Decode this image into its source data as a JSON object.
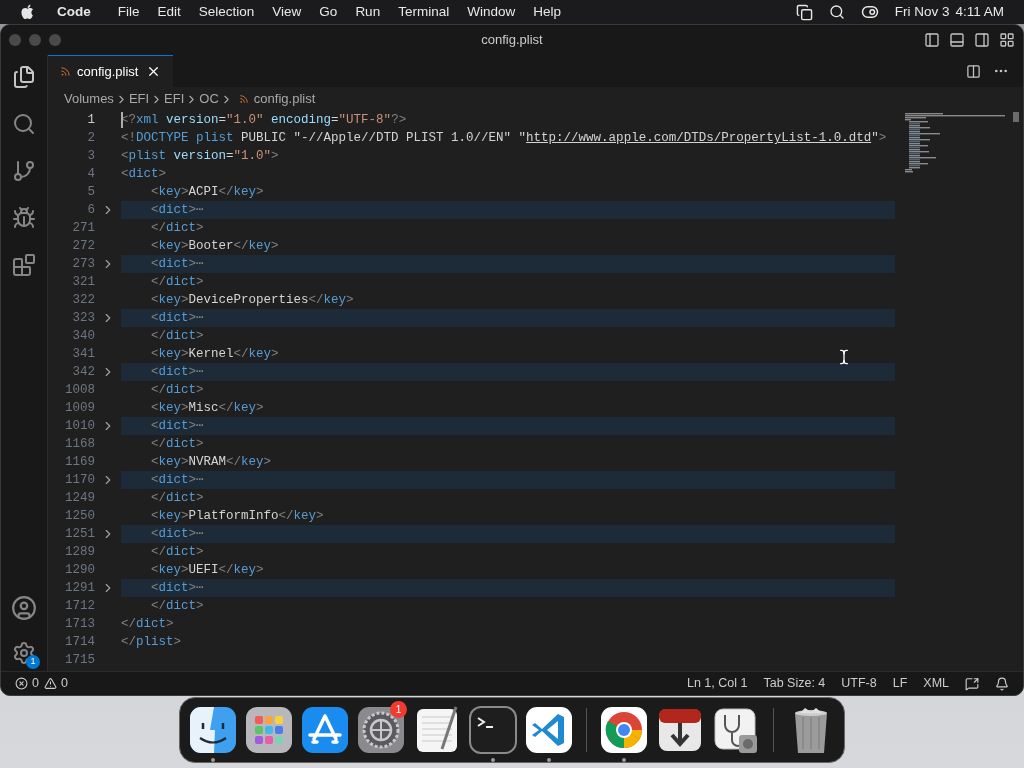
{
  "menubar": {
    "app": "Code",
    "menus": [
      "File",
      "Edit",
      "Selection",
      "View",
      "Go",
      "Run",
      "Terminal",
      "Window",
      "Help"
    ],
    "date": "Fri Nov 3",
    "time": "4:11 AM"
  },
  "window": {
    "title": "config.plist"
  },
  "activity_bar": {
    "settings_badge": "1"
  },
  "tabs": [
    {
      "label": "config.plist",
      "selected": true
    }
  ],
  "breadcrumbs": [
    "Volumes",
    "EFI",
    "EFI",
    "OC",
    "config.plist"
  ],
  "editor": {
    "lines": [
      {
        "number": "1",
        "current": true,
        "folded": false,
        "tokens": [
          {
            "kind": "punct",
            "text": "<?"
          },
          {
            "kind": "tag",
            "text": "xml"
          },
          {
            "kind": "attr",
            "text": " version"
          },
          {
            "kind": "text",
            "text": "="
          },
          {
            "kind": "string",
            "text": "\"1.0\""
          },
          {
            "kind": "attr",
            "text": " encoding"
          },
          {
            "kind": "text",
            "text": "="
          },
          {
            "kind": "string",
            "text": "\"UTF-8\""
          },
          {
            "kind": "punct",
            "text": "?>"
          }
        ]
      },
      {
        "number": "2",
        "current": false,
        "folded": false,
        "tokens": [
          {
            "kind": "punct",
            "text": "<!"
          },
          {
            "kind": "tag",
            "text": "DOCTYPE plist"
          },
          {
            "kind": "text",
            "text": " PUBLIC \"-//Apple//DTD PLIST 1.0//EN\" \""
          },
          {
            "kind": "link",
            "text": "http://www.apple.com/DTDs/PropertyList-1.0.dtd"
          },
          {
            "kind": "text",
            "text": "\""
          },
          {
            "kind": "punct",
            "text": ">"
          }
        ]
      },
      {
        "number": "3",
        "current": false,
        "folded": false,
        "tokens": [
          {
            "kind": "punct",
            "text": "<"
          },
          {
            "kind": "tag",
            "text": "plist"
          },
          {
            "kind": "attr",
            "text": " version"
          },
          {
            "kind": "text",
            "text": "="
          },
          {
            "kind": "string",
            "text": "\"1.0\""
          },
          {
            "kind": "punct",
            "text": ">"
          }
        ]
      },
      {
        "number": "4",
        "current": false,
        "folded": false,
        "tokens": [
          {
            "kind": "punct",
            "text": "<"
          },
          {
            "kind": "tag",
            "text": "dict"
          },
          {
            "kind": "punct",
            "text": ">"
          }
        ]
      },
      {
        "number": "5",
        "current": false,
        "folded": false,
        "tokens": [
          {
            "kind": "punct",
            "text": "    <"
          },
          {
            "kind": "tag",
            "text": "key"
          },
          {
            "kind": "punct",
            "text": ">"
          },
          {
            "kind": "text",
            "text": "ACPI"
          },
          {
            "kind": "punct",
            "text": "</"
          },
          {
            "kind": "tag",
            "text": "key"
          },
          {
            "kind": "punct",
            "text": ">"
          }
        ]
      },
      {
        "number": "6",
        "current": false,
        "folded": true,
        "tokens": [
          {
            "kind": "punct",
            "text": "    <"
          },
          {
            "kind": "tag",
            "text": "dict"
          },
          {
            "kind": "punct",
            "text": ">"
          },
          {
            "kind": "ellipsis",
            "text": "⋯"
          }
        ]
      },
      {
        "number": "271",
        "current": false,
        "folded": false,
        "tokens": [
          {
            "kind": "punct",
            "text": "    </"
          },
          {
            "kind": "tag",
            "text": "dict"
          },
          {
            "kind": "punct",
            "text": ">"
          }
        ]
      },
      {
        "number": "272",
        "current": false,
        "folded": false,
        "tokens": [
          {
            "kind": "punct",
            "text": "    <"
          },
          {
            "kind": "tag",
            "text": "key"
          },
          {
            "kind": "punct",
            "text": ">"
          },
          {
            "kind": "text",
            "text": "Booter"
          },
          {
            "kind": "punct",
            "text": "</"
          },
          {
            "kind": "tag",
            "text": "key"
          },
          {
            "kind": "punct",
            "text": ">"
          }
        ]
      },
      {
        "number": "273",
        "current": false,
        "folded": true,
        "tokens": [
          {
            "kind": "punct",
            "text": "    <"
          },
          {
            "kind": "tag",
            "text": "dict"
          },
          {
            "kind": "punct",
            "text": ">"
          },
          {
            "kind": "ellipsis",
            "text": "⋯"
          }
        ]
      },
      {
        "number": "321",
        "current": false,
        "folded": false,
        "tokens": [
          {
            "kind": "punct",
            "text": "    </"
          },
          {
            "kind": "tag",
            "text": "dict"
          },
          {
            "kind": "punct",
            "text": ">"
          }
        ]
      },
      {
        "number": "322",
        "current": false,
        "folded": false,
        "tokens": [
          {
            "kind": "punct",
            "text": "    <"
          },
          {
            "kind": "tag",
            "text": "key"
          },
          {
            "kind": "punct",
            "text": ">"
          },
          {
            "kind": "text",
            "text": "DeviceProperties"
          },
          {
            "kind": "punct",
            "text": "</"
          },
          {
            "kind": "tag",
            "text": "key"
          },
          {
            "kind": "punct",
            "text": ">"
          }
        ]
      },
      {
        "number": "323",
        "current": false,
        "folded": true,
        "tokens": [
          {
            "kind": "punct",
            "text": "    <"
          },
          {
            "kind": "tag",
            "text": "dict"
          },
          {
            "kind": "punct",
            "text": ">"
          },
          {
            "kind": "ellipsis",
            "text": "⋯"
          }
        ]
      },
      {
        "number": "340",
        "current": false,
        "folded": false,
        "tokens": [
          {
            "kind": "punct",
            "text": "    </"
          },
          {
            "kind": "tag",
            "text": "dict"
          },
          {
            "kind": "punct",
            "text": ">"
          }
        ]
      },
      {
        "number": "341",
        "current": false,
        "folded": false,
        "tokens": [
          {
            "kind": "punct",
            "text": "    <"
          },
          {
            "kind": "tag",
            "text": "key"
          },
          {
            "kind": "punct",
            "text": ">"
          },
          {
            "kind": "text",
            "text": "Kernel"
          },
          {
            "kind": "punct",
            "text": "</"
          },
          {
            "kind": "tag",
            "text": "key"
          },
          {
            "kind": "punct",
            "text": ">"
          }
        ]
      },
      {
        "number": "342",
        "current": false,
        "folded": true,
        "tokens": [
          {
            "kind": "punct",
            "text": "    <"
          },
          {
            "kind": "tag",
            "text": "dict"
          },
          {
            "kind": "punct",
            "text": ">"
          },
          {
            "kind": "ellipsis",
            "text": "⋯"
          }
        ]
      },
      {
        "number": "1008",
        "current": false,
        "folded": false,
        "tokens": [
          {
            "kind": "punct",
            "text": "    </"
          },
          {
            "kind": "tag",
            "text": "dict"
          },
          {
            "kind": "punct",
            "text": ">"
          }
        ]
      },
      {
        "number": "1009",
        "current": false,
        "folded": false,
        "tokens": [
          {
            "kind": "punct",
            "text": "    <"
          },
          {
            "kind": "tag",
            "text": "key"
          },
          {
            "kind": "punct",
            "text": ">"
          },
          {
            "kind": "text",
            "text": "Misc"
          },
          {
            "kind": "punct",
            "text": "</"
          },
          {
            "kind": "tag",
            "text": "key"
          },
          {
            "kind": "punct",
            "text": ">"
          }
        ]
      },
      {
        "number": "1010",
        "current": false,
        "folded": true,
        "tokens": [
          {
            "kind": "punct",
            "text": "    <"
          },
          {
            "kind": "tag",
            "text": "dict"
          },
          {
            "kind": "punct",
            "text": ">"
          },
          {
            "kind": "ellipsis",
            "text": "⋯"
          }
        ]
      },
      {
        "number": "1168",
        "current": false,
        "folded": false,
        "tokens": [
          {
            "kind": "punct",
            "text": "    </"
          },
          {
            "kind": "tag",
            "text": "dict"
          },
          {
            "kind": "punct",
            "text": ">"
          }
        ]
      },
      {
        "number": "1169",
        "current": false,
        "folded": false,
        "tokens": [
          {
            "kind": "punct",
            "text": "    <"
          },
          {
            "kind": "tag",
            "text": "key"
          },
          {
            "kind": "punct",
            "text": ">"
          },
          {
            "kind": "text",
            "text": "NVRAM"
          },
          {
            "kind": "punct",
            "text": "</"
          },
          {
            "kind": "tag",
            "text": "key"
          },
          {
            "kind": "punct",
            "text": ">"
          }
        ]
      },
      {
        "number": "1170",
        "current": false,
        "folded": true,
        "tokens": [
          {
            "kind": "punct",
            "text": "    <"
          },
          {
            "kind": "tag",
            "text": "dict"
          },
          {
            "kind": "punct",
            "text": ">"
          },
          {
            "kind": "ellipsis",
            "text": "⋯"
          }
        ]
      },
      {
        "number": "1249",
        "current": false,
        "folded": false,
        "tokens": [
          {
            "kind": "punct",
            "text": "    </"
          },
          {
            "kind": "tag",
            "text": "dict"
          },
          {
            "kind": "punct",
            "text": ">"
          }
        ]
      },
      {
        "number": "1250",
        "current": false,
        "folded": false,
        "tokens": [
          {
            "kind": "punct",
            "text": "    <"
          },
          {
            "kind": "tag",
            "text": "key"
          },
          {
            "kind": "punct",
            "text": ">"
          },
          {
            "kind": "text",
            "text": "PlatformInfo"
          },
          {
            "kind": "punct",
            "text": "</"
          },
          {
            "kind": "tag",
            "text": "key"
          },
          {
            "kind": "punct",
            "text": ">"
          }
        ]
      },
      {
        "number": "1251",
        "current": false,
        "folded": true,
        "tokens": [
          {
            "kind": "punct",
            "text": "    <"
          },
          {
            "kind": "tag",
            "text": "dict"
          },
          {
            "kind": "punct",
            "text": ">"
          },
          {
            "kind": "ellipsis",
            "text": "⋯"
          }
        ]
      },
      {
        "number": "1289",
        "current": false,
        "folded": false,
        "tokens": [
          {
            "kind": "punct",
            "text": "    </"
          },
          {
            "kind": "tag",
            "text": "dict"
          },
          {
            "kind": "punct",
            "text": ">"
          }
        ]
      },
      {
        "number": "1290",
        "current": false,
        "folded": false,
        "tokens": [
          {
            "kind": "punct",
            "text": "    <"
          },
          {
            "kind": "tag",
            "text": "key"
          },
          {
            "kind": "punct",
            "text": ">"
          },
          {
            "kind": "text",
            "text": "UEFI"
          },
          {
            "kind": "punct",
            "text": "</"
          },
          {
            "kind": "tag",
            "text": "key"
          },
          {
            "kind": "punct",
            "text": ">"
          }
        ]
      },
      {
        "number": "1291",
        "current": false,
        "folded": true,
        "tokens": [
          {
            "kind": "punct",
            "text": "    <"
          },
          {
            "kind": "tag",
            "text": "dict"
          },
          {
            "kind": "punct",
            "text": ">"
          },
          {
            "kind": "ellipsis",
            "text": "⋯"
          }
        ]
      },
      {
        "number": "1712",
        "current": false,
        "folded": false,
        "tokens": [
          {
            "kind": "punct",
            "text": "    </"
          },
          {
            "kind": "tag",
            "text": "dict"
          },
          {
            "kind": "punct",
            "text": ">"
          }
        ]
      },
      {
        "number": "1713",
        "current": false,
        "folded": false,
        "tokens": [
          {
            "kind": "punct",
            "text": "</"
          },
          {
            "kind": "tag",
            "text": "dict"
          },
          {
            "kind": "punct",
            "text": ">"
          }
        ]
      },
      {
        "number": "1714",
        "current": false,
        "folded": false,
        "tokens": [
          {
            "kind": "punct",
            "text": "</"
          },
          {
            "kind": "tag",
            "text": "plist"
          },
          {
            "kind": "punct",
            "text": ">"
          }
        ]
      },
      {
        "number": "1715",
        "current": false,
        "folded": false
      }
    ]
  },
  "status_bar": {
    "errors": "0",
    "warnings": "0",
    "items": [
      "Ln 1, Col 1",
      "Tab Size: 4",
      "UTF-8",
      "LF",
      "XML"
    ]
  },
  "dock": {
    "groups": [
      [
        {
          "kind": "finder",
          "running": true
        },
        {
          "kind": "launchpad",
          "running": false
        },
        {
          "kind": "appstore",
          "running": false
        },
        {
          "kind": "settings",
          "running": false,
          "badge": "1"
        },
        {
          "kind": "textedit",
          "running": false
        },
        {
          "kind": "terminal",
          "running": true
        },
        {
          "kind": "vscode",
          "running": true
        }
      ],
      [
        {
          "kind": "chrome",
          "running": true
        },
        {
          "kind": "installer",
          "running": false
        },
        {
          "kind": "diskutility",
          "running": false
        }
      ],
      [
        {
          "kind": "trash",
          "running": false
        }
      ]
    ]
  }
}
